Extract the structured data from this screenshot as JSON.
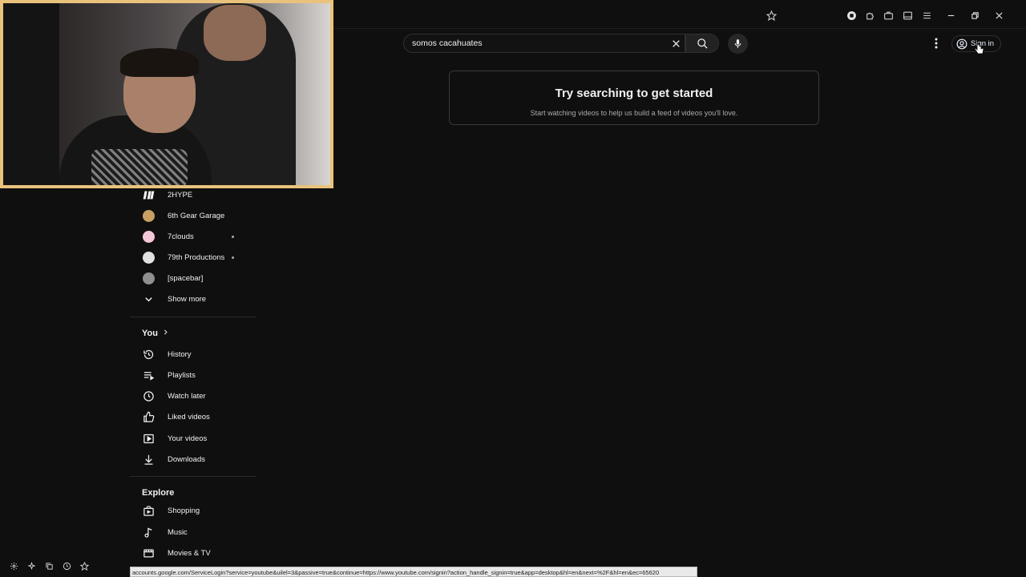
{
  "search": {
    "query": "somos cacahuates"
  },
  "header": {
    "sign_in": "Sign in"
  },
  "prompt": {
    "title": "Try searching to get started",
    "subtitle": "Start watching videos to help us build a feed of videos you'll love."
  },
  "sidebar": {
    "subscriptions": [
      {
        "label": "2HYPE",
        "color": "#ffffff"
      },
      {
        "label": "6th Gear Garage",
        "color": "#c8a063"
      },
      {
        "label": "7clouds",
        "color": "#f3c6d8"
      },
      {
        "label": "79th Productions",
        "color": "#e0e0e0"
      },
      {
        "label": "[spacebar]",
        "color": "#8f8f8f"
      }
    ],
    "show_more": "Show more",
    "you_heading": "You",
    "you_items": [
      "History",
      "Playlists",
      "Watch later",
      "Liked videos",
      "Your videos",
      "Downloads"
    ],
    "explore_heading": "Explore",
    "explore_items": [
      "Shopping",
      "Music",
      "Movies & TV"
    ]
  },
  "status_bar": {
    "url": "accounts.google.com/ServiceLogin?service=youtube&uilel=3&passive=true&continue=https://www.youtube.com/signin?action_handle_signin=true&app=desktop&hl=en&next=%2F&hl=en&ec=65620"
  },
  "icons": {
    "browser": [
      "star-icon",
      "extension-badge-icon",
      "puzzle-icon",
      "briefcase-icon",
      "sidebar-panel-icon",
      "menu-icon"
    ],
    "window": [
      "minimize-icon",
      "restore-icon",
      "close-icon"
    ],
    "dock": [
      "settings-icon",
      "sparkle-icon",
      "copy-icon",
      "clock-icon",
      "bookmark-star-icon"
    ]
  },
  "colors": {
    "background": "#0f0f0f",
    "accent": "#3ea6ff",
    "webcam_border": "#e9c27c"
  }
}
